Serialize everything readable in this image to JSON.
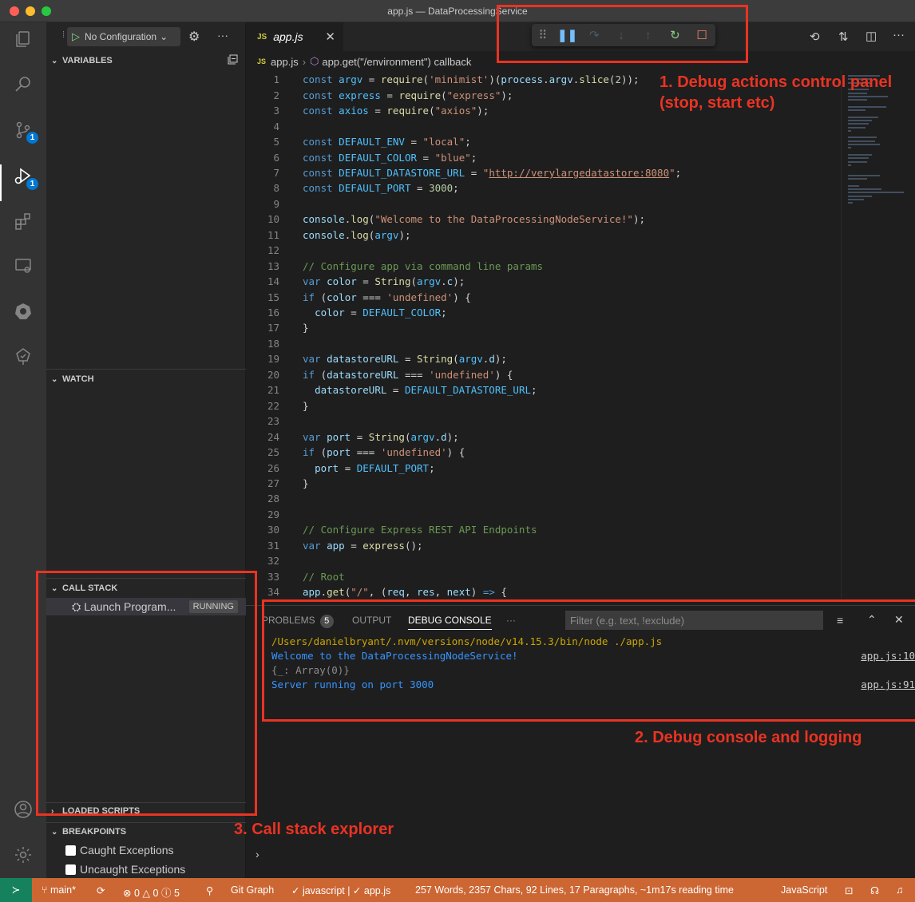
{
  "window": {
    "title": "app.js — DataProcessingService"
  },
  "activity_bar": {
    "scm_badge": "1",
    "debug_badge": "1"
  },
  "sidebar": {
    "run_config": "No Configuration",
    "variables_header": "VARIABLES",
    "watch_header": "WATCH",
    "call_stack_header": "CALL STACK",
    "call_stack_item": "Launch Program...",
    "call_stack_status": "RUNNING",
    "loaded_scripts_header": "LOADED SCRIPTS",
    "breakpoints_header": "BREAKPOINTS",
    "breakpoints": [
      "Caught Exceptions",
      "Uncaught Exceptions"
    ]
  },
  "editor": {
    "tab_badge": "JS",
    "tab_label": "app.js",
    "breadcrumb_file": "app.js",
    "breadcrumb_symbol": "app.get(\"/environment\") callback",
    "lines": [
      {
        "n": "1",
        "html": "<span class='kw'>const</span> <span class='cst'>argv</span> = <span class='fn'>require</span>(<span class='str'>'minimist'</span>)(<span class='var'>process</span>.<span class='var'>argv</span>.<span class='fn'>slice</span>(<span class='num'>2</span>));"
      },
      {
        "n": "2",
        "html": "<span class='kw'>const</span> <span class='cst'>express</span> = <span class='fn'>require</span>(<span class='str'>\"express\"</span>);"
      },
      {
        "n": "3",
        "html": "<span class='kw'>const</span> <span class='cst'>axios</span> = <span class='fn'>require</span>(<span class='str'>\"axios\"</span>);"
      },
      {
        "n": "4",
        "html": ""
      },
      {
        "n": "5",
        "html": "<span class='kw'>const</span> <span class='cst'>DEFAULT_ENV</span> = <span class='str'>\"local\"</span>;"
      },
      {
        "n": "6",
        "html": "<span class='kw'>const</span> <span class='cst'>DEFAULT_COLOR</span> = <span class='str'>\"blue\"</span>;"
      },
      {
        "n": "7",
        "html": "<span class='kw'>const</span> <span class='cst'>DEFAULT_DATASTORE_URL</span> = <span class='str'>\"<u>http://verylargedatastore:8080</u>\"</span>;"
      },
      {
        "n": "8",
        "html": "<span class='kw'>const</span> <span class='cst'>DEFAULT_PORT</span> = <span class='num'>3000</span>;"
      },
      {
        "n": "9",
        "html": ""
      },
      {
        "n": "10",
        "html": "<span class='var'>console</span>.<span class='fn'>log</span>(<span class='str'>\"Welcome to the DataProcessingNodeService!\"</span>);"
      },
      {
        "n": "11",
        "html": "<span class='var'>console</span>.<span class='fn'>log</span>(<span class='cst'>argv</span>);"
      },
      {
        "n": "12",
        "html": ""
      },
      {
        "n": "13",
        "html": "<span class='cm'>// Configure app via command line params</span>"
      },
      {
        "n": "14",
        "html": "<span class='kw'>var</span> <span class='var'>color</span> = <span class='fn'>String</span>(<span class='cst'>argv</span>.<span class='var'>c</span>);"
      },
      {
        "n": "15",
        "html": "<span class='kw'>if</span> (<span class='var'>color</span> === <span class='str'>'undefined'</span>) {"
      },
      {
        "n": "16",
        "html": "  <span class='var'>color</span> = <span class='cst'>DEFAULT_COLOR</span>;"
      },
      {
        "n": "17",
        "html": "}"
      },
      {
        "n": "18",
        "html": ""
      },
      {
        "n": "19",
        "html": "<span class='kw'>var</span> <span class='var'>datastoreURL</span> = <span class='fn'>String</span>(<span class='cst'>argv</span>.<span class='var'>d</span>);"
      },
      {
        "n": "20",
        "html": "<span class='kw'>if</span> (<span class='var'>datastoreURL</span> === <span class='str'>'undefined'</span>) {"
      },
      {
        "n": "21",
        "html": "  <span class='var'>datastoreURL</span> = <span class='cst'>DEFAULT_DATASTORE_URL</span>;"
      },
      {
        "n": "22",
        "html": "}"
      },
      {
        "n": "23",
        "html": ""
      },
      {
        "n": "24",
        "html": "<span class='kw'>var</span> <span class='var'>port</span> = <span class='fn'>String</span>(<span class='cst'>argv</span>.<span class='var'>d</span>);"
      },
      {
        "n": "25",
        "html": "<span class='kw'>if</span> (<span class='var'>port</span> === <span class='str'>'undefined'</span>) {"
      },
      {
        "n": "26",
        "html": "  <span class='var'>port</span> = <span class='cst'>DEFAULT_PORT</span>;"
      },
      {
        "n": "27",
        "html": "}"
      },
      {
        "n": "28",
        "html": ""
      },
      {
        "n": "29",
        "html": ""
      },
      {
        "n": "30",
        "html": "<span class='cm'>// Configure Express REST API Endpoints</span>"
      },
      {
        "n": "31",
        "html": "<span class='kw'>var</span> <span class='var'>app</span> = <span class='fn'>express</span>();"
      },
      {
        "n": "32",
        "html": ""
      },
      {
        "n": "33",
        "html": "<span class='cm'>// Root</span>"
      },
      {
        "n": "34",
        "html": "<span class='var'>app</span>.<span class='fn'>get</span>(<span class='str'>\"/\"</span>, (<span class='var'>req</span>, <span class='var'>res</span>, <span class='var'>next</span>) <span class='kw'>=&gt;</span> {"
      }
    ]
  },
  "panel": {
    "tabs": {
      "problems": "PROBLEMS",
      "problems_count": "5",
      "output": "OUTPUT",
      "debug_console": "DEBUG CONSOLE",
      "more": "···"
    },
    "filter_placeholder": "Filter (e.g. text, !exclude)",
    "console": [
      {
        "text": "/Users/danielbryant/.nvm/versions/node/v14.15.3/bin/node ./app.js",
        "color": "#cca700",
        "source": ""
      },
      {
        "text": "Welcome to the DataProcessingNodeService!",
        "color": "#3794ff",
        "source": "app.js:10"
      },
      {
        "text": "{_: Array(0)}",
        "color": "#8c8c8c",
        "source": ""
      },
      {
        "text": "Server running on port 3000",
        "color": "#3794ff",
        "source": "app.js:91"
      }
    ]
  },
  "statusbar": {
    "branch": "main*",
    "errors": "0",
    "warnings": "0",
    "infos": "5",
    "git_graph": "Git Graph",
    "lint": "✓ javascript | ✓ app.js",
    "stats": "257 Words, 2357 Chars, 92 Lines, 17 Paragraphs, ~1m17s reading time",
    "language": "JavaScript"
  },
  "annotations": {
    "debug_actions_line1": "1. Debug actions control panel",
    "debug_actions_line2": "(stop, start etc)",
    "debug_console": "2. Debug console and logging",
    "call_stack": "3. Call stack explorer",
    "color": "#ea3323"
  },
  "colors": {
    "accent": "#0078d4",
    "statusbar": "#cc6633",
    "remote": "#16825d"
  }
}
